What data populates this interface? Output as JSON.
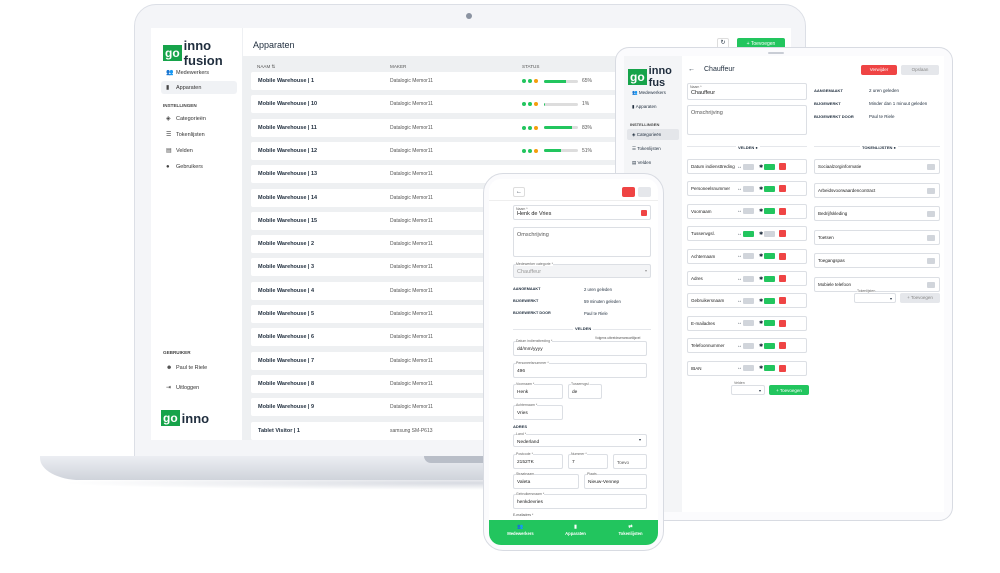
{
  "laptop": {
    "logo_go": "go",
    "logo_rest": "inno fusion",
    "page_title": "Apparaten",
    "add_button": "+ Toevoegen",
    "nav": [
      {
        "label": "Medewerkers",
        "icon": "people-icon"
      },
      {
        "label": "Apparaten",
        "icon": "device-icon"
      }
    ],
    "settings_heading": "INSTELLINGEN",
    "settings_nav": [
      {
        "label": "Categorieën",
        "icon": "layers-icon"
      },
      {
        "label": "Tokenlijsten",
        "icon": "list-icon"
      },
      {
        "label": "Velden",
        "icon": "fields-icon"
      },
      {
        "label": "Gebruikers",
        "icon": "user-icon"
      }
    ],
    "user_heading": "GEBRUIKER",
    "user_name": "Paul te Riele",
    "logout": "Uitloggen",
    "bottom_logo_go": "go",
    "bottom_logo_rest": "inno",
    "table": {
      "headers": [
        "NAAM ⇅",
        "MAKER",
        "STATUS"
      ],
      "rows": [
        {
          "name": "Mobile Warehouse | 1",
          "maker": "Datalogic Memor11",
          "status": "65%",
          "level": 0.65
        },
        {
          "name": "Mobile Warehouse | 10",
          "maker": "Datalogic Memor11",
          "status": "1%",
          "level": 0.01
        },
        {
          "name": "Mobile Warehouse | 11",
          "maker": "Datalogic Memor11",
          "status": "83%",
          "level": 0.83
        },
        {
          "name": "Mobile Warehouse | 12",
          "maker": "Datalogic Memor11",
          "status": "51%",
          "level": 0.51
        },
        {
          "name": "Mobile Warehouse | 13",
          "maker": "Datalogic Memor11"
        },
        {
          "name": "Mobile Warehouse | 14",
          "maker": "Datalogic Memor11"
        },
        {
          "name": "Mobile Warehouse | 15",
          "maker": "Datalogic Memor11"
        },
        {
          "name": "Mobile Warehouse | 2",
          "maker": "Datalogic Memor11"
        },
        {
          "name": "Mobile Warehouse | 3",
          "maker": "Datalogic Memor11"
        },
        {
          "name": "Mobile Warehouse | 4",
          "maker": "Datalogic Memor11"
        },
        {
          "name": "Mobile Warehouse | 5",
          "maker": "Datalogic Memor11"
        },
        {
          "name": "Mobile Warehouse | 6",
          "maker": "Datalogic Memor11"
        },
        {
          "name": "Mobile Warehouse | 7",
          "maker": "Datalogic Memor11"
        },
        {
          "name": "Mobile Warehouse | 8",
          "maker": "Datalogic Memor11"
        },
        {
          "name": "Mobile Warehouse | 9",
          "maker": "Datalogic Memor11"
        },
        {
          "name": "Tablet Visitor | 1",
          "maker": "samsung SM-P613"
        }
      ]
    }
  },
  "tablet": {
    "logo_go": "go",
    "logo_rest": "inno fus",
    "title": "Chauffeur",
    "delete_button": "Verwijder",
    "save_button": "Opslaan",
    "nav": [
      "Medewerkers",
      "Apparaten"
    ],
    "settings_heading": "INSTELLINGEN",
    "settings_nav": [
      "Categorieën",
      "Tokenlijsten",
      "Velden"
    ],
    "name_label": "Naam *",
    "name_value": "Chauffeur",
    "description_placeholder": "Omschrijving",
    "meta": [
      {
        "label": "AANGEMAAKT",
        "value": "2 uren geleden"
      },
      {
        "label": "BIJGEWERKT",
        "value": "Minder dan 1 minuut geleden"
      },
      {
        "label": "BIJGEWERKT DOOR",
        "value": "Paul te Riele"
      }
    ],
    "fields_heading": "VELDEN",
    "tokenlists_heading": "TOKENLIJSTEN",
    "fields": [
      "Datum indiensttreding",
      "Personeelsnummer",
      "Voornaam",
      "Tussenvgsl.",
      "Achternaam",
      "Adres",
      "Gebruikersnaam",
      "E-mailadres",
      "Telefoonnummer",
      "IBAN"
    ],
    "tokenlists": [
      "Sociaalzorginformatie",
      "Arbeidsvoorwaardencontract",
      "Bedrijfskleding",
      "Toetsen",
      "Toegangspas",
      "Mobiele telefoon"
    ],
    "select_label": "Velden",
    "select_label2": "Tokenlijsten",
    "add_button": "+ Toevoegen"
  },
  "phone": {
    "name_label": "Naam *",
    "name_value": "Henk de Vries",
    "description_placeholder": "Omschrijving",
    "category_label": "Medewerker categorie *",
    "category_value": "Chauffeur",
    "meta": [
      {
        "label": "AANGEMAAKT",
        "value": "2 uren geleden"
      },
      {
        "label": "BIJGEWERKT",
        "value": "59 minuten geleden"
      },
      {
        "label": "BIJGEWERKT DOOR",
        "value": "Paul te Riele"
      }
    ],
    "fields_heading": "VELDEN",
    "hint": "Volgens utbreidsveranwortlijsvel",
    "date_label": "Datum indiensttreding *",
    "date_value": "dd/mm/yyyy",
    "staff_label": "Personeelsnummer *",
    "staff_value": "496",
    "first_label": "Voornaam *",
    "first_value": "Henk",
    "infix_label": "Tussenvgsl.",
    "infix_value": "de",
    "last_label": "Achternaam *",
    "last_value": "Vries",
    "address_heading": "ADRES",
    "country_label": "Land *",
    "country_value": "Nederland",
    "zip_label": "Postcode *",
    "zip_value": "2152TK",
    "house_label": "Nummer *",
    "house_value": "7",
    "add_label": "Toevo",
    "street_label": "Straatnaam",
    "street_value": "Valeta",
    "city_label": "Plaats",
    "city_value": "Nieuw-Vennep",
    "user_label": "Gebruikersnaam *",
    "user_value": "henkdevries",
    "email_label": "E-mailadres *",
    "tabs": [
      {
        "label": "Medewerkers",
        "icon": "people-icon"
      },
      {
        "label": "Apparaten",
        "icon": "device-icon"
      },
      {
        "label": "Tokenlijsten",
        "icon": "list-icon"
      }
    ]
  }
}
